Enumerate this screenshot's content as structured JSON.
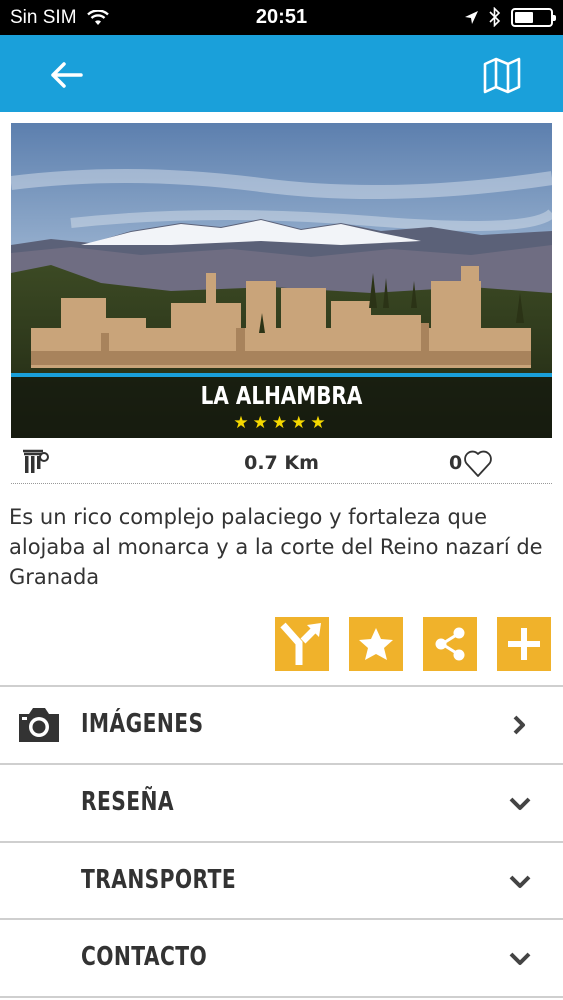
{
  "status_bar": {
    "carrier": "Sin SIM",
    "time": "20:51"
  },
  "nav": {
    "back_icon": "arrow-left-icon",
    "map_icon": "map-icon",
    "color": "#1aa0da"
  },
  "place": {
    "title": "LA ALHAMBRA",
    "stars": "★★★★★",
    "rating": 5,
    "distance": "0.7 Km",
    "likes": "0",
    "description": "Es un rico complejo palaciego y fortaleza que alojaba al monarca y a la corte del Reino nazarí de Granada"
  },
  "actions": [
    {
      "icon": "directions-icon"
    },
    {
      "icon": "star-icon"
    },
    {
      "icon": "share-icon"
    },
    {
      "icon": "plus-icon"
    }
  ],
  "accent_color": "#f0b22b",
  "sections": [
    {
      "label": "IMÁGENES",
      "icon": "camera-icon",
      "arrow": "chevron-right-icon"
    },
    {
      "label": "RESEÑA",
      "arrow": "chevron-down-icon"
    },
    {
      "label": "TRANSPORTE",
      "arrow": "chevron-down-icon"
    },
    {
      "label": "CONTACTO",
      "arrow": "chevron-down-icon"
    }
  ]
}
